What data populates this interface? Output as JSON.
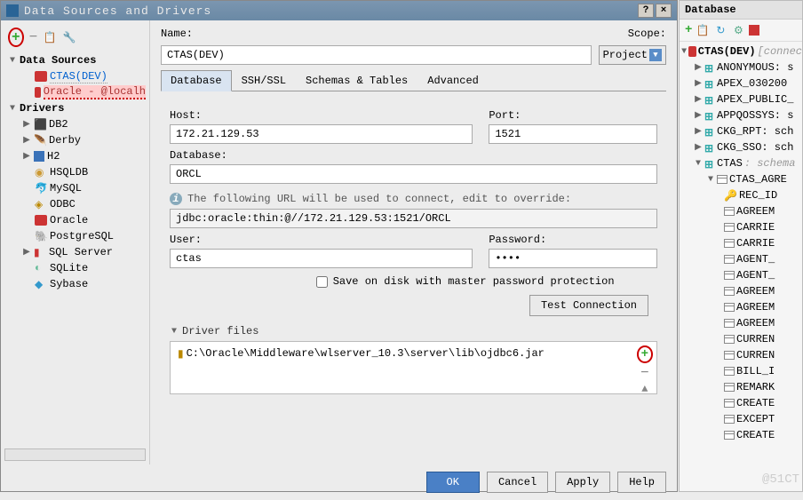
{
  "dialog": {
    "title": "Data Sources and Drivers",
    "name_label": "Name:",
    "scope_label": "Scope:",
    "name_value": "CTAS(DEV)",
    "scope_value": "Project",
    "tabs": [
      "Database",
      "SSH/SSL",
      "Schemas & Tables",
      "Advanced"
    ],
    "host_label": "Host:",
    "host_value": "172.21.129.53",
    "port_label": "Port:",
    "port_value": "1521",
    "database_label": "Database:",
    "database_value": "ORCL",
    "info_text": "The following URL will be used to connect, edit to override:",
    "url_value": "jdbc:oracle:thin:@//172.21.129.53:1521/ORCL",
    "user_label": "User:",
    "user_value": "ctas",
    "password_label": "Password:",
    "password_value": "••••",
    "save_pwd_label": "Save on disk with master password protection",
    "test_btn": "Test Connection",
    "driver_hdr": "Driver files",
    "driver_path": "C:\\Oracle\\Middleware\\wlserver_10.3\\server\\lib\\ojdbc6.jar",
    "ok": "OK",
    "cancel": "Cancel",
    "apply": "Apply",
    "help": "Help"
  },
  "tree": {
    "ds_header": "Data Sources",
    "ds": [
      "CTAS(DEV)",
      "Oracle - @localh"
    ],
    "drv_header": "Drivers",
    "drv": [
      "DB2",
      "Derby",
      "H2",
      "HSQLDB",
      "MySQL",
      "ODBC",
      "Oracle",
      "PostgreSQL",
      "SQL Server",
      "SQLite",
      "Sybase"
    ]
  },
  "dbpanel": {
    "title": "Database",
    "root": "CTAS(DEV)",
    "root_suffix": "[connec",
    "schemas": [
      "ANONYMOUS: s",
      "APEX_030200",
      "APEX_PUBLIC_",
      "APPQOSSYS: s",
      "CKG_RPT: sch",
      "CKG_SSO: sch"
    ],
    "ctas_schema": "CTAS",
    "ctas_suffix": ": schema",
    "ctas_table": "CTAS_AGRE",
    "cols": [
      "REC_ID",
      "AGREEM",
      "CARRIE",
      "CARRIE",
      "AGENT_",
      "AGENT_",
      "AGREEM",
      "AGREEM",
      "AGREEM",
      "CURREN",
      "CURREN",
      "BILL_I",
      "REMARK",
      "CREATE",
      "EXCEPT",
      "CREATE"
    ]
  },
  "watermark": "@51CT"
}
